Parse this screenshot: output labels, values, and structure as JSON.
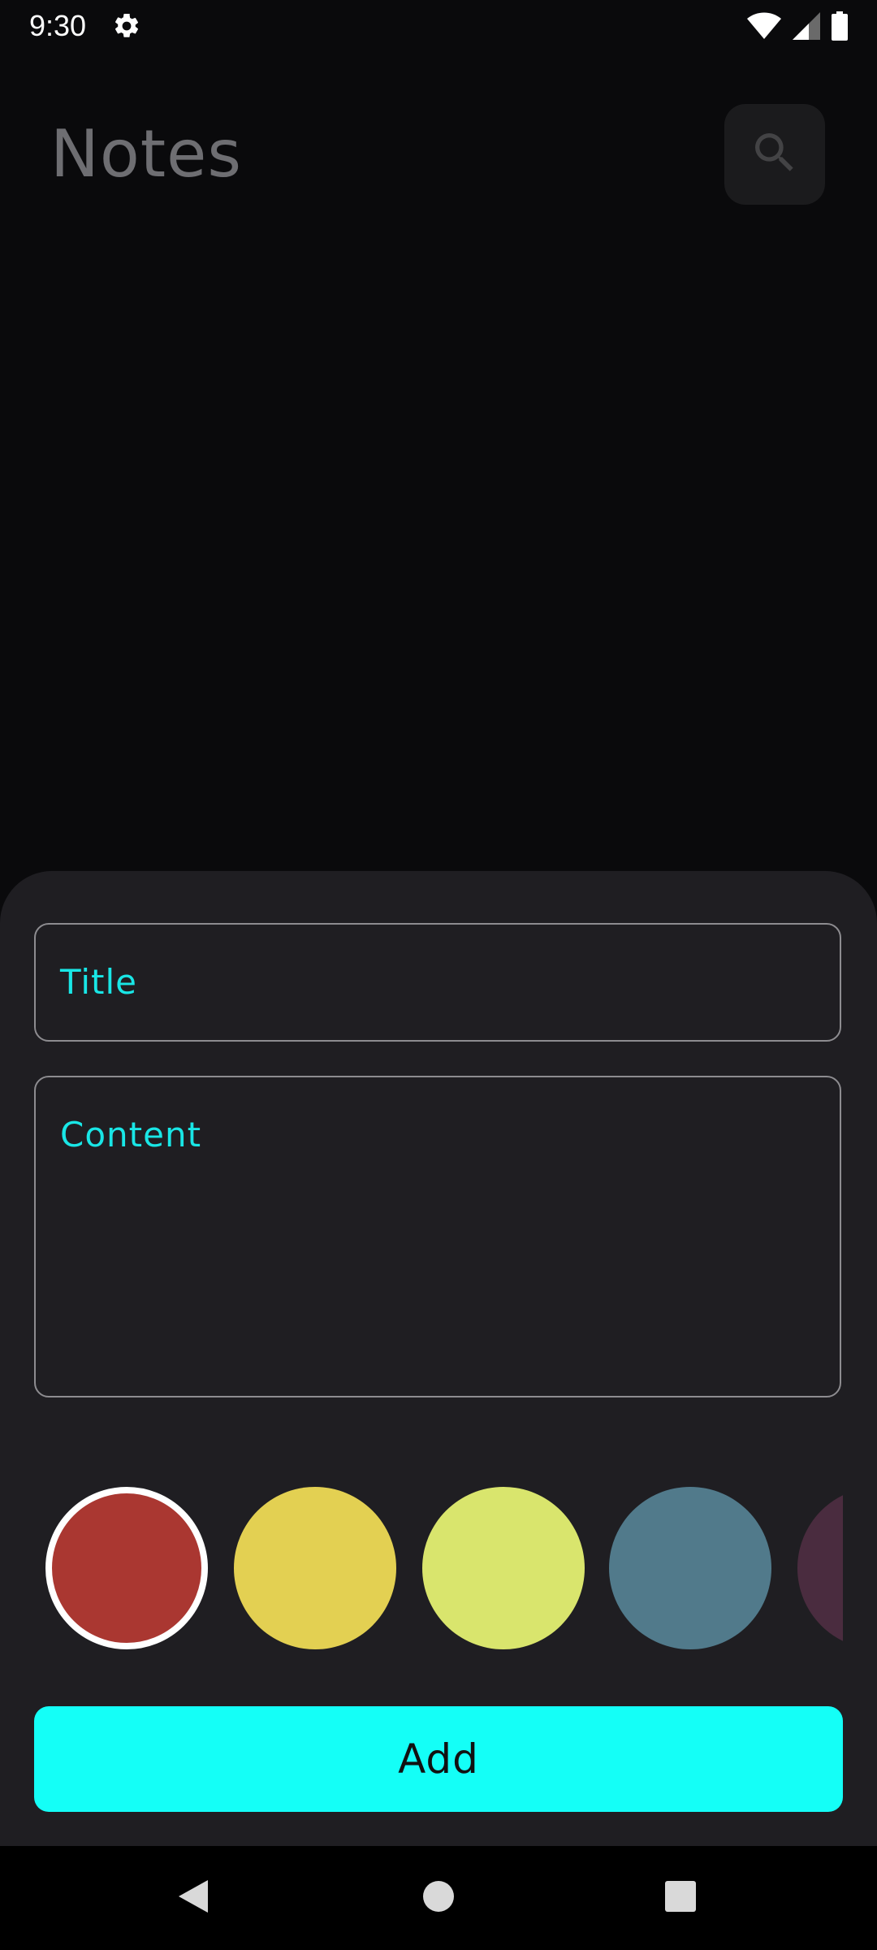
{
  "status_bar": {
    "time": "9:30",
    "icons": [
      "settings-gear-icon",
      "wifi-icon",
      "cellular-signal-icon",
      "battery-icon"
    ]
  },
  "app": {
    "title": "Notes",
    "search_icon": "search-icon"
  },
  "sheet": {
    "title_label": "Title",
    "content_label": "Content",
    "colors": [
      {
        "name": "red",
        "hex": "#aa3731",
        "selected": true
      },
      {
        "name": "yellow",
        "hex": "#e3d052",
        "selected": false
      },
      {
        "name": "lime",
        "hex": "#d9e56d",
        "selected": false
      },
      {
        "name": "steel-blue",
        "hex": "#517a8b",
        "selected": false
      },
      {
        "name": "plum",
        "hex": "#4a2c3f",
        "selected": false
      }
    ],
    "add_label": "Add"
  },
  "navigation": {
    "buttons": [
      "back-icon",
      "home-icon",
      "recents-icon"
    ]
  },
  "theme": {
    "accent": "#14fff7",
    "label_color": "#19e6e6",
    "sheet_background": "#1f1e22",
    "screen_background": "#0a0a0c"
  }
}
